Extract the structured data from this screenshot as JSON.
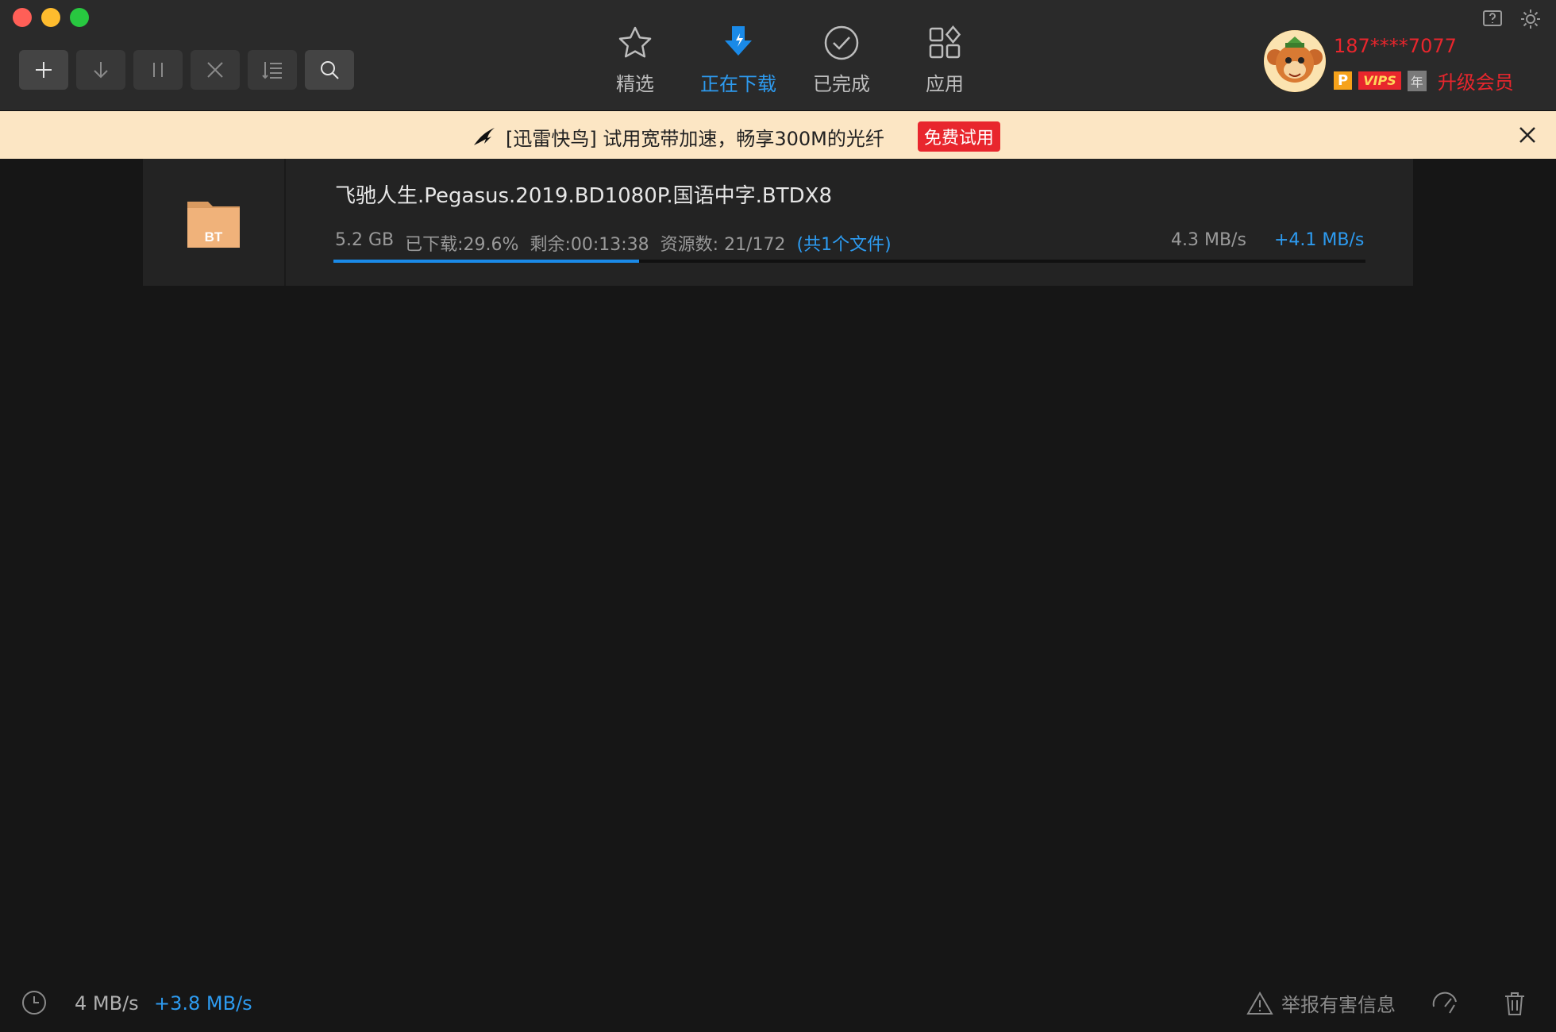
{
  "toolbar": {
    "buttons": [
      "add",
      "download",
      "pause",
      "delete",
      "sort",
      "search"
    ],
    "tabs": [
      {
        "label": "精选",
        "icon": "star-icon"
      },
      {
        "label": "正在下载",
        "icon": "download-bolt-icon",
        "active": true
      },
      {
        "label": "已完成",
        "icon": "check-circle-icon"
      },
      {
        "label": "应用",
        "icon": "apps-grid-icon"
      }
    ]
  },
  "user": {
    "phone": "187****7077",
    "badge_p": "P",
    "badge_vip": "VIPS",
    "badge_year": "年",
    "upgrade": "升级会员"
  },
  "banner": {
    "text": "[迅雷快鸟] 试用宽带加速，畅享300M的光纤",
    "button": "免费试用"
  },
  "task": {
    "title": "飞驰人生.Pegasus.2019.BD1080P.国语中字.BTDX8",
    "folder_label": "BT",
    "size": "5.2 GB",
    "downloaded": "已下载:29.6%",
    "remaining": "剩余:00:13:38",
    "sources": "资源数: 21/172",
    "files_link": "(共1个文件)",
    "speed": "4.3 MB/s",
    "boost": "+4.1 MB/s",
    "progress": 0.296
  },
  "statusbar": {
    "speed": "4 MB/s",
    "boost": "+3.8 MB/s",
    "report": "举报有害信息"
  },
  "colors": {
    "accent": "#2d9bf0",
    "vip_red": "#e8262d",
    "banner_bg": "#fce6c4",
    "folder": "#f0b27a"
  }
}
